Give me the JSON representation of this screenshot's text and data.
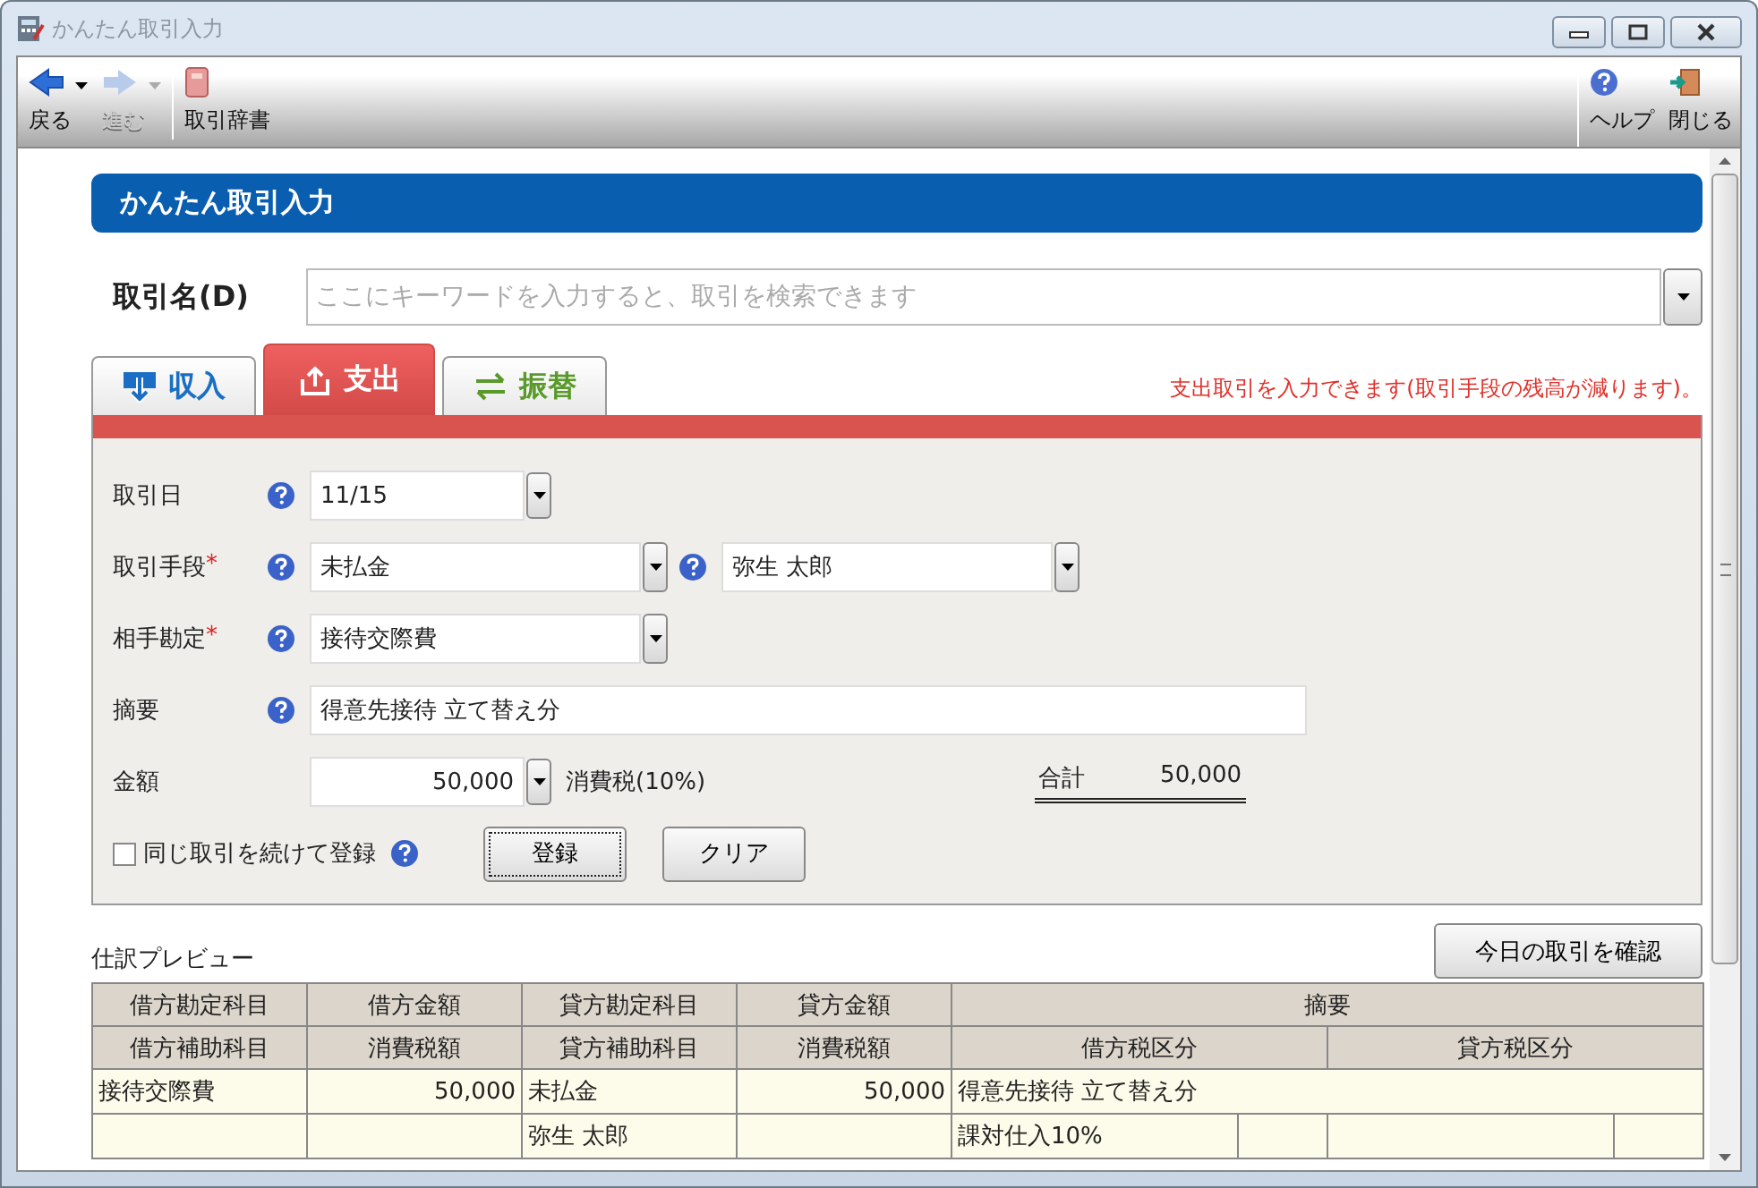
{
  "window": {
    "title": "かんたん取引入力"
  },
  "toolbar": {
    "left": [
      {
        "kind": "back",
        "label": "戻る",
        "disabled": false,
        "dropdown": true
      },
      {
        "kind": "forward",
        "label": "進む",
        "disabled": true,
        "dropdown": true
      },
      {
        "kind": "dictionary",
        "label": "取引辞書",
        "disabled": false,
        "dropdown": false
      }
    ],
    "right": [
      {
        "kind": "help",
        "label": "ヘルプ",
        "disabled": false,
        "dropdown": false
      },
      {
        "kind": "exit",
        "label": "閉じる",
        "disabled": false,
        "dropdown": false
      }
    ]
  },
  "header": "かんたん取引入力",
  "transaction_name": {
    "label": "取引名(D)",
    "placeholder": "ここにキーワードを入力すると、取引を検索できます"
  },
  "tabs": [
    {
      "kind": "income",
      "label": "収入",
      "selected": false
    },
    {
      "kind": "expense",
      "label": "支出",
      "selected": true
    },
    {
      "kind": "transfer",
      "label": "振替",
      "selected": false
    }
  ],
  "tab_hint": "支出取引を入力できます(取引手段の残高が減ります)。",
  "form": {
    "date": {
      "label": "取引日",
      "value": "11/15"
    },
    "method": {
      "label": "取引手段",
      "required_mark": "*",
      "value": "未払金",
      "sub_value": "弥生 太郎"
    },
    "counter": {
      "label": "相手勘定",
      "required_mark": "*",
      "value": "接待交際費"
    },
    "summary": {
      "label": "摘要",
      "value": "得意先接待 立て替え分"
    },
    "amount": {
      "label": "金額",
      "value": "50,000",
      "tax_label": "消費税(10%)",
      "total_label": "合計",
      "total_value": "50,000"
    },
    "repeat": {
      "label": "同じ取引を続けて登録",
      "checked": false
    },
    "buttons": [
      {
        "label": "登録",
        "focused": true
      },
      {
        "label": "クリア",
        "focused": false
      }
    ]
  },
  "preview": {
    "title": "仕訳プレビュー",
    "confirm_button": "今日の取引を確認",
    "columns": [
      {
        "label": "借方勘定科目",
        "sub_label": "借方補助科目"
      },
      {
        "label": "借方金額",
        "sub_label": "消費税額"
      },
      {
        "label": "貸方勘定科目",
        "sub_label": "貸方補助科目"
      },
      {
        "label": "貸方金額",
        "sub_label": "消費税額"
      }
    ],
    "summary_header": "摘要",
    "tax_headers": [
      "借方税区分",
      "貸方税区分"
    ],
    "entries": [
      {
        "debit_account": "接待交際費",
        "debit_amount": "50,000",
        "credit_account": "未払金",
        "credit_amount": "50,000",
        "summary": "得意先接待 立て替え分",
        "credit_sub_account": "弥生 太郎",
        "debit_tax_class": "課対仕入10%"
      }
    ]
  }
}
